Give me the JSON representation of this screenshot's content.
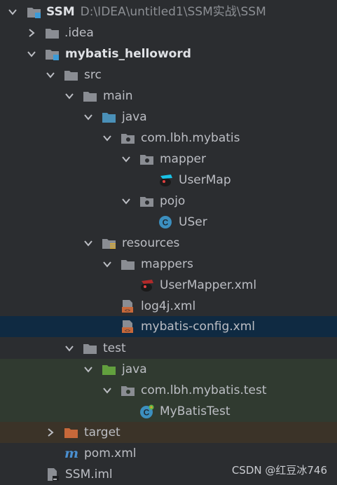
{
  "project": {
    "root_name": "SSM",
    "root_path": "D:\\IDEA\\untitled1\\SSM实战\\SSM",
    "idea": ".idea",
    "module": "mybatis_helloword",
    "src": "src",
    "main": "main",
    "java": "java",
    "pkg": "com.lbh.mybatis",
    "mapper": "mapper",
    "usermap": "UserMap",
    "pojo": "pojo",
    "user": "USer",
    "resources": "resources",
    "mappers": "mappers",
    "usermapper_xml": "UserMapper.xml",
    "log4j": "log4j.xml",
    "mybatis_config": "mybatis-config.xml",
    "test": "test",
    "test_java": "java",
    "test_pkg": "com.lbh.mybatis.test",
    "mybatistest": "MyBatisTest",
    "target": "target",
    "pom": "pom.xml",
    "iml": "SSM.iml"
  },
  "watermark": "CSDN @红豆冰746",
  "colors": {
    "background": "#2b2d30",
    "selected_row": "#0f2a42",
    "test_row": "#303a30",
    "excluded_row": "#3b3328",
    "folder": "#8a8d93",
    "source_folder": "#4a90b8",
    "test_folder": "#62a03e",
    "excluded_folder": "#c7683a",
    "class_icon": "#3c8fbf"
  }
}
